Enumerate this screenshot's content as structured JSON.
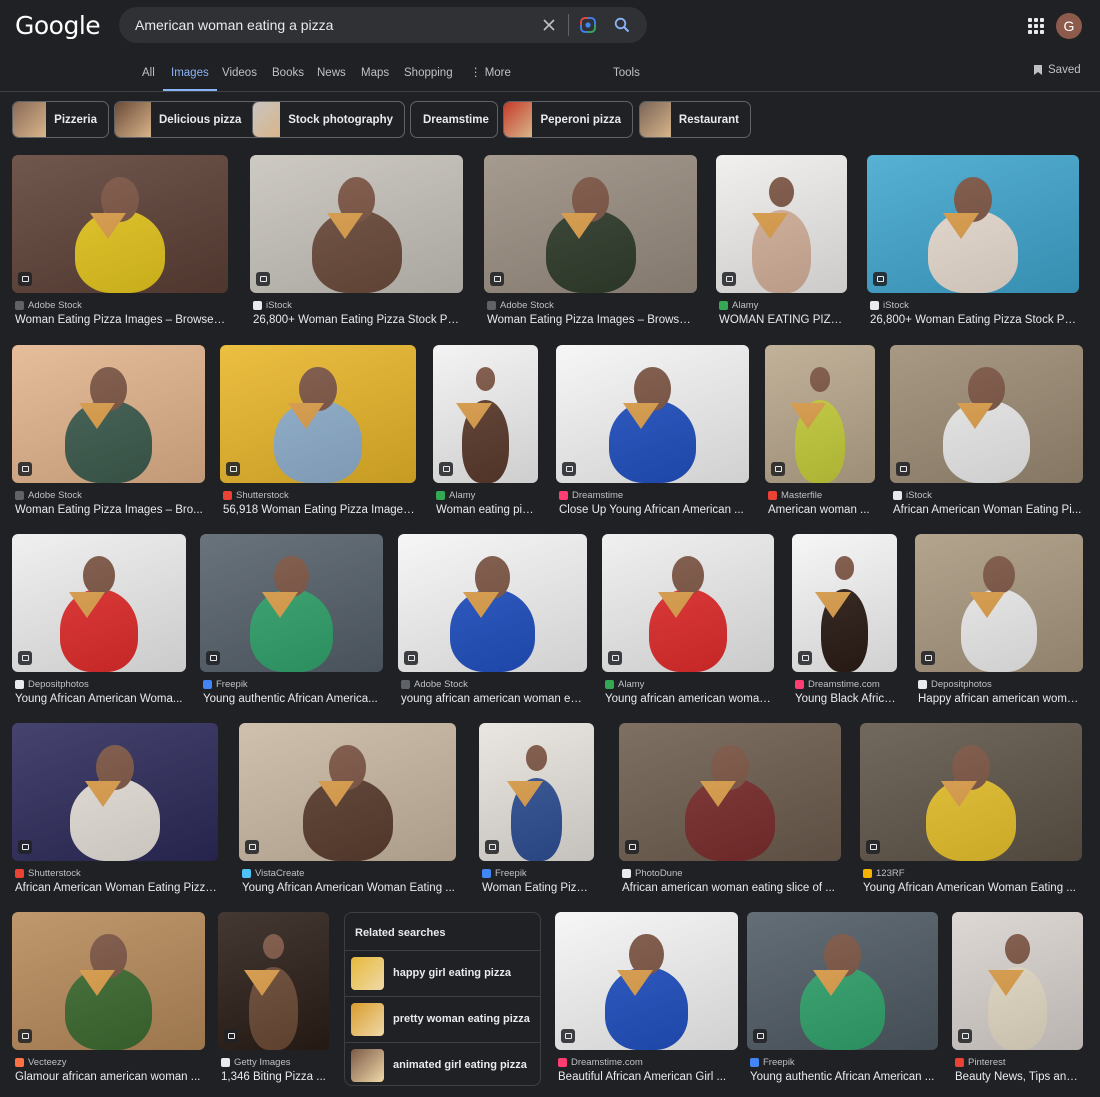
{
  "header": {
    "logo": "Google",
    "search_value": "American woman eating a pizza",
    "avatar_letter": "G"
  },
  "tabs": [
    {
      "label": "All"
    },
    {
      "label": "Images",
      "active": true
    },
    {
      "label": "Videos"
    },
    {
      "label": "Books"
    },
    {
      "label": "News"
    },
    {
      "label": "Maps"
    },
    {
      "label": "Shopping"
    },
    {
      "label": "⋮ More"
    },
    {
      "label": "Tools"
    }
  ],
  "saved_label": "Saved",
  "chips": [
    {
      "label": "Pizzeria",
      "thumb": "#8a6a58"
    },
    {
      "label": "Delicious pizza",
      "thumb": "#6b4a38"
    },
    {
      "label": "Stock photography",
      "thumb": "#c9c4c0"
    },
    {
      "label": "Dreamstime"
    },
    {
      "label": "Peperoni pizza",
      "thumb": "#c63b2a"
    },
    {
      "label": "Restaurant",
      "thumb": "#7a6558"
    }
  ],
  "results": [
    {
      "source": "Adobe Stock",
      "title": "Woman Eating Pizza Images – Browse 7...",
      "bg": "#5c4036",
      "fig": "#e7c71c",
      "fav": "#5f6368"
    },
    {
      "source": "iStock",
      "title": "26,800+ Woman Eating Pizza Stock Phot...",
      "bg": "#c7c2bb",
      "fig": "#6b4a3a",
      "fav": "#e8eaed"
    },
    {
      "source": "Adobe Stock",
      "title": "Woman Eating Pizza Images – Browse 7...",
      "bg": "#9a8d80",
      "fig": "#2e3b2a",
      "fav": "#5f6368"
    },
    {
      "source": "Alamy",
      "title": "WOMAN EATING PIZZ...",
      "bg": "#efeeec",
      "fig": "#d7b39c",
      "fav": "#34a853"
    },
    {
      "source": "iStock",
      "title": "26,800+ Woman Eating Pizza Stock Phot...",
      "bg": "#3fa6cf",
      "fig": "#ecdfd3",
      "fav": "#e8eaed"
    },
    {
      "source": "Adobe Stock",
      "title": "Woman Eating Pizza Images – Bro...",
      "bg": "#e3b48c",
      "fig": "#3b5a4c",
      "fav": "#5f6368"
    },
    {
      "source": "Shutterstock",
      "title": "56,918 Woman Eating Pizza Images...",
      "bg": "#e9b628",
      "fig": "#8fb0cf",
      "fav": "#ea4335"
    },
    {
      "source": "Alamy",
      "title": "Woman eating pizz...",
      "bg": "#f2f2f2",
      "fig": "#5b3a2b",
      "fav": "#34a853"
    },
    {
      "source": "Dreamstime",
      "title": "Close Up Young African American ...",
      "bg": "#f5f5f5",
      "fig": "#1f4fc2",
      "fav": "#ff3d71"
    },
    {
      "source": "Masterfile",
      "title": "American woman ...",
      "bg": "#b9a78c",
      "fig": "#c8cf3a",
      "fav": "#ea4335"
    },
    {
      "source": "iStock",
      "title": "African American Woman Eating Pi...",
      "bg": "#9c8b74",
      "fig": "#eeeeee",
      "fav": "#e8eaed"
    },
    {
      "source": "Depositphotos",
      "title": "Young African American Woma...",
      "bg": "#eeeeee",
      "fig": "#e32a2a",
      "fav": "#e8eaed"
    },
    {
      "source": "Freepik",
      "title": "Young authentic African America...",
      "bg": "#55606a",
      "fig": "#2fa36b",
      "fav": "#4285f4"
    },
    {
      "source": "Adobe Stock",
      "title": "young african american woman eat...",
      "bg": "#f5f5f5",
      "fig": "#1f4fc2",
      "fav": "#5f6368"
    },
    {
      "source": "Alamy",
      "title": "Young african american woman...",
      "bg": "#eeeeee",
      "fig": "#e32a2a",
      "fav": "#34a853"
    },
    {
      "source": "Dreamstime.com",
      "title": "Young Black Africa...",
      "bg": "#f5f5f5",
      "fig": "#2a1a14",
      "fav": "#ff3d71"
    },
    {
      "source": "Depositphotos",
      "title": "Happy african american woma...",
      "bg": "#a9987f",
      "fig": "#f0f0f0",
      "fav": "#e8eaed"
    },
    {
      "source": "Shutterstock",
      "title": "African American Woman Eating Pizza ...",
      "bg": "#2c2a5a",
      "fig": "#e9e2dc",
      "fav": "#ea4335"
    },
    {
      "source": "VistaCreate",
      "title": "Young African American Woman Eating ...",
      "bg": "#c9b8a2",
      "fig": "#5a3b2d",
      "fav": "#4fc3f7"
    },
    {
      "source": "Freepik",
      "title": "Woman Eating Pizza ...",
      "bg": "#e7e3dd",
      "fig": "#2d4f95",
      "fav": "#4285f4"
    },
    {
      "source": "PhotoDune",
      "title": "African american woman eating slice of ...",
      "bg": "#6d5c4e",
      "fig": "#7a2a2a",
      "fav": "#e8eaed"
    },
    {
      "source": "123RF",
      "title": "Young African American Woman Eating ...",
      "bg": "#5e5448",
      "fig": "#e8c22a",
      "fav": "#f5b400"
    },
    {
      "source": "Vecteezy",
      "title": "Glamour african american woman ...",
      "bg": "#b78a5a",
      "fig": "#3b6a2f",
      "fav": "#ff7043"
    },
    {
      "source": "Getty Images",
      "title": "1,346 Biting Pizza ...",
      "bg": "#2b1d17",
      "fig": "#6b4a34",
      "fav": "#e8eaed"
    },
    {
      "source": "Dreamstime.com",
      "title": "Beautiful African American Girl ...",
      "bg": "#f5f5f5",
      "fig": "#1f4fc2",
      "fav": "#ff3d71"
    },
    {
      "source": "Freepik",
      "title": "Young authentic African American ...",
      "bg": "#4f5a63",
      "fig": "#2fa36b",
      "fav": "#4285f4"
    },
    {
      "source": "Pinterest",
      "title": "Beauty News, Tips and...",
      "bg": "#d9d3cf",
      "fig": "#e8ddc8",
      "fav": "#ea4335"
    }
  ],
  "related": {
    "title": "Related searches",
    "items": [
      {
        "label": "happy girl eating pizza",
        "thumb": "#e6b93a"
      },
      {
        "label": "pretty woman eating pizza",
        "thumb": "#d99c2e"
      },
      {
        "label": "animated girl eating pizza",
        "thumb": "#7c5a48"
      }
    ]
  }
}
